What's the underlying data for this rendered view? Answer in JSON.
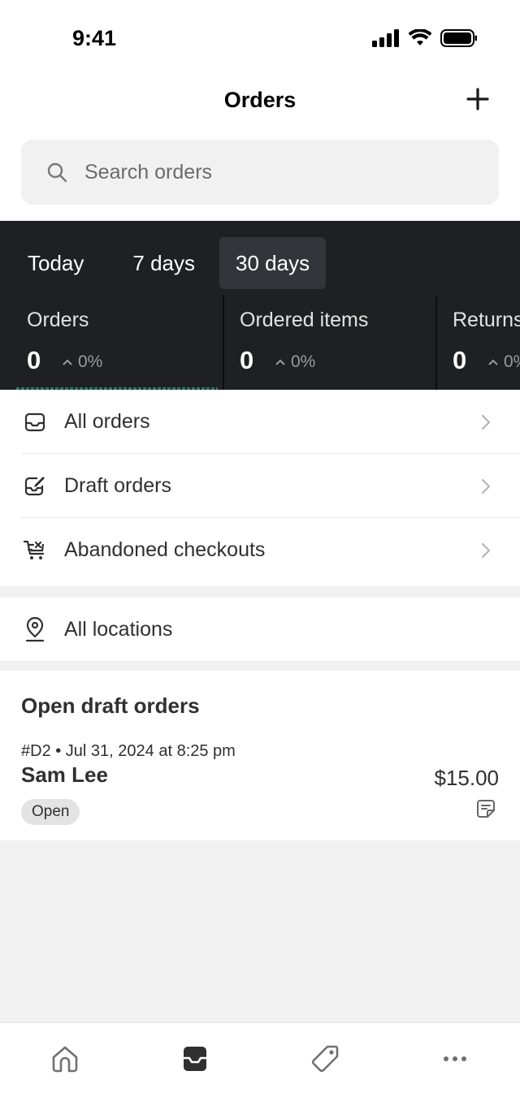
{
  "status_bar": {
    "time": "9:41"
  },
  "header": {
    "title": "Orders",
    "add_icon": "plus-icon"
  },
  "search": {
    "placeholder": "Search orders",
    "value": ""
  },
  "stats": {
    "ranges": [
      {
        "label": "Today",
        "selected": false
      },
      {
        "label": "7 days",
        "selected": false
      },
      {
        "label": "30 days",
        "selected": true
      }
    ],
    "metrics": [
      {
        "label": "Orders",
        "value": "0",
        "change": "0%"
      },
      {
        "label": "Ordered items",
        "value": "0",
        "change": "0%"
      },
      {
        "label": "Returns",
        "value": "0",
        "change": "0%"
      }
    ]
  },
  "nav": {
    "items": [
      {
        "label": "All orders",
        "icon": "inbox-icon"
      },
      {
        "label": "Draft orders",
        "icon": "draft-order-icon"
      },
      {
        "label": "Abandoned checkouts",
        "icon": "cart-abandoned-icon"
      }
    ]
  },
  "locations": {
    "label": "All locations",
    "icon": "location-pin-icon"
  },
  "drafts": {
    "title": "Open draft orders",
    "orders": [
      {
        "meta": "#D2 • Jul 31, 2024 at 8:25 pm",
        "customer": "Sam Lee",
        "amount": "$15.00",
        "status": "Open"
      }
    ]
  },
  "tab_bar": {
    "tabs": [
      {
        "icon": "home-icon"
      },
      {
        "icon": "orders-inbox-icon",
        "selected": true
      },
      {
        "icon": "products-tag-icon"
      },
      {
        "icon": "more-icon"
      }
    ]
  },
  "colors": {
    "stats_background": "#1f2024",
    "selected_range": "#34353a",
    "page_background": "#f1f1f1",
    "text": "#303030"
  }
}
